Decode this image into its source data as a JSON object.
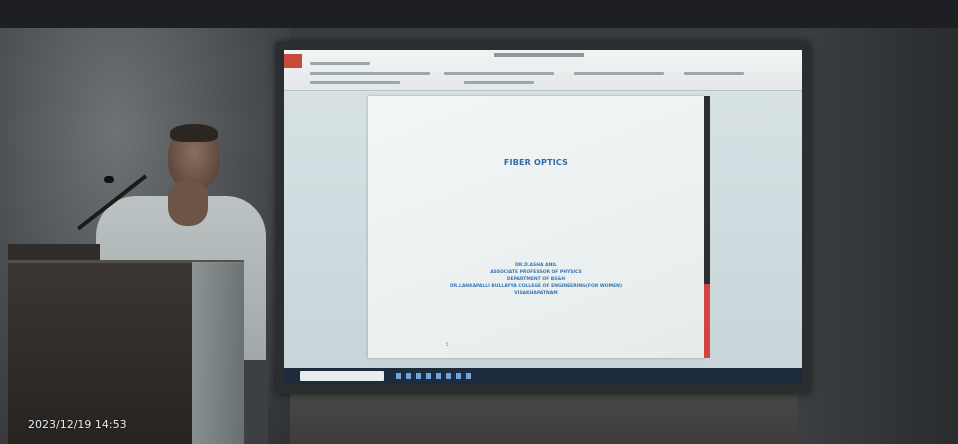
{
  "slide": {
    "title": "FIBER OPTICS",
    "info_lines": [
      "DR.D.ASHA ANIL",
      "ASSOCIATE PROFESSOR OF PHYSICS",
      "DEPARTMENT OF BS&H",
      "DR.LANKAPALLI BULLAYYA COLLEGE OF ENGINEERING(FOR WOMEN)",
      "VISAKHAPATNAM"
    ],
    "page_number": "5"
  },
  "photo": {
    "timestamp": "2023/12/19 14:53"
  },
  "colors": {
    "slide_text": "#3677b4",
    "taskbar": "#1e2b3c",
    "scroll_accent": "#d24343"
  }
}
